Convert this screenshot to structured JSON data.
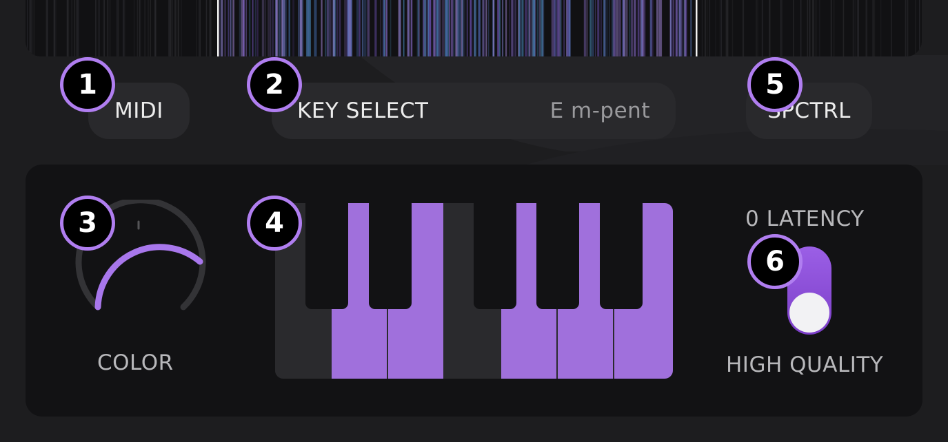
{
  "buttons": {
    "midi": "MIDI",
    "key_select_label": "KEY SELECT",
    "key_select_value": "E m-pent",
    "spctrl": "SPCTRL"
  },
  "controls": {
    "color_label": "COLOR",
    "latency_label": "0 LATENCY",
    "quality_label": "HIGH QUALITY",
    "toggle_state": "high quality"
  },
  "badges": [
    "1",
    "2",
    "3",
    "4",
    "5",
    "6"
  ],
  "colors": {
    "accent": "#b07ef0",
    "key_purple": "#a070dc",
    "background": "#1d1d1f"
  },
  "icons": {
    "knob": "color-knob-icon",
    "keyboard": "piano-keyboard-icon",
    "toggle": "quality-toggle-icon"
  }
}
